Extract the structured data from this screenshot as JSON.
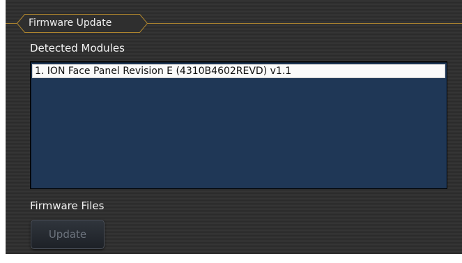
{
  "tab": {
    "title": "Firmware Update"
  },
  "modules": {
    "label": "Detected Modules",
    "items": [
      {
        "text": "1. ION Face Panel Revision E (4310B4602REVD) v1.1"
      }
    ]
  },
  "files": {
    "label": "Firmware Files"
  },
  "actions": {
    "update_label": "Update",
    "update_enabled": false
  },
  "colors": {
    "frame_accent": "#b0862e",
    "list_background": "#1f3756",
    "selected_row": "#fafafa",
    "panel_background": "#2e2e2e"
  }
}
